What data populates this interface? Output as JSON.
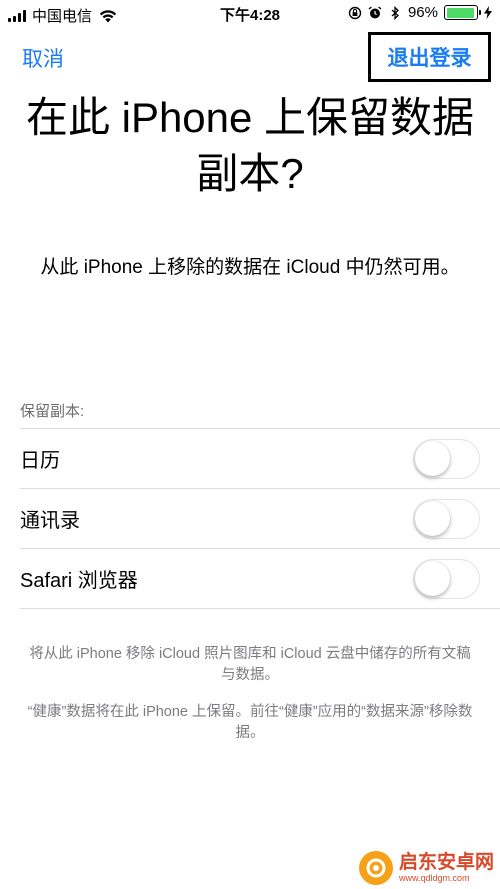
{
  "status_bar": {
    "carrier": "中国电信",
    "time": "下午4:28",
    "battery_percent": "96%",
    "battery_level": 0.96,
    "battery_color": "#4cd964"
  },
  "nav": {
    "cancel_label": "取消",
    "signout_label": "退出登录"
  },
  "title": "在此 iPhone 上保留数据副本?",
  "subtitle": "从此 iPhone 上移除的数据在 iCloud 中仍然可用。",
  "section_header": "保留副本:",
  "items": [
    {
      "label": "日历",
      "enabled": false
    },
    {
      "label": "通讯录",
      "enabled": false
    },
    {
      "label": "Safari 浏览器",
      "enabled": false
    }
  ],
  "footer": {
    "note1": "将从此 iPhone 移除 iCloud 照片图库和 iCloud 云盘中储存的所有文稿与数据。",
    "note2": "“健康”数据将在此 iPhone 上保留。前往“健康”应用的“数据来源”移除数据。"
  },
  "watermark": {
    "name": "启东安卓网",
    "url": "www.qdldgm.com"
  },
  "colors": {
    "accent": "#1a7cf3",
    "secondary_text": "#7c7c80"
  }
}
